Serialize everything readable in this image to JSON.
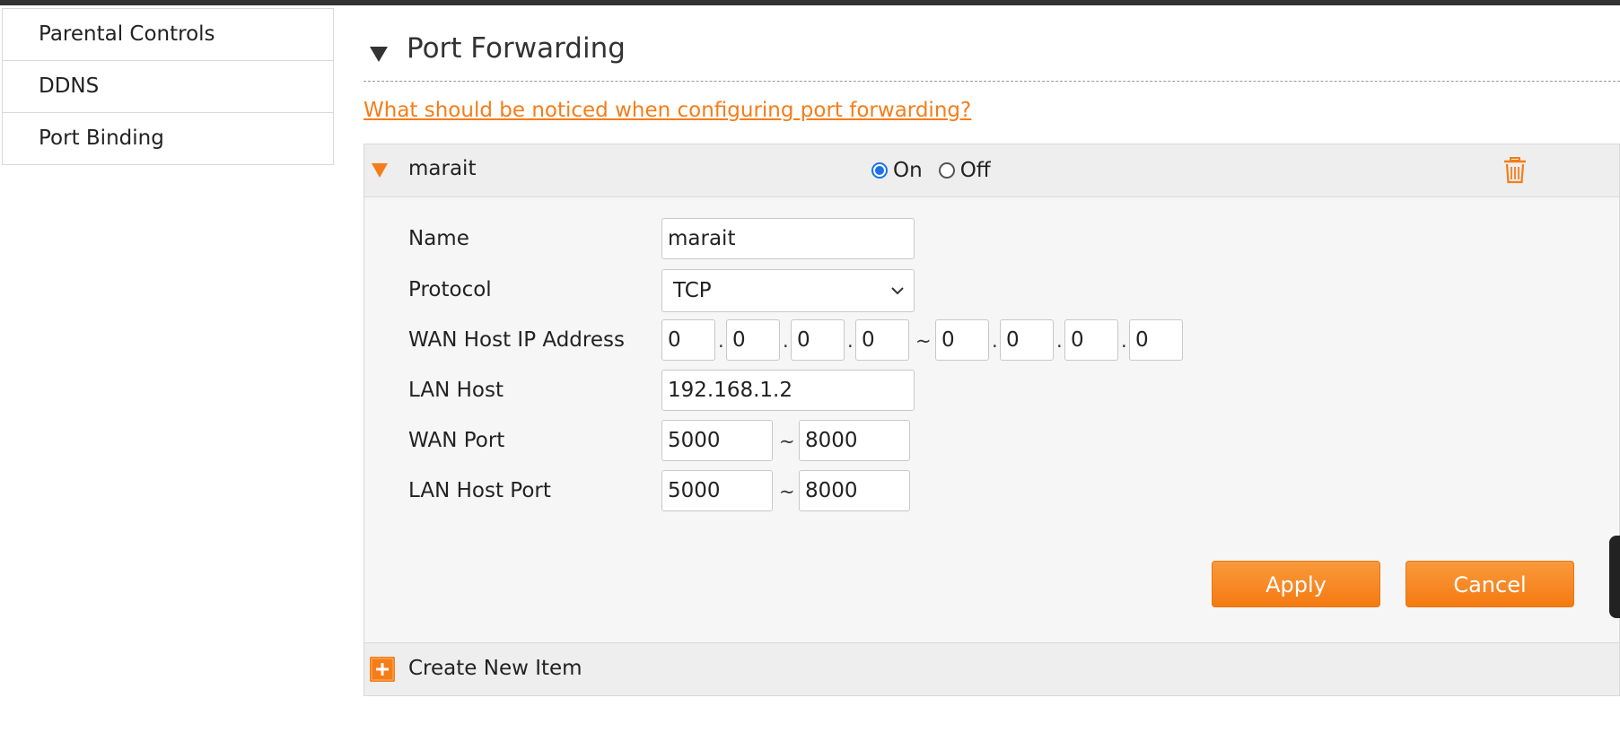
{
  "sidebar": {
    "items": [
      {
        "label": "Parental Controls"
      },
      {
        "label": "DDNS"
      },
      {
        "label": "Port Binding"
      }
    ]
  },
  "section": {
    "title": "Port Forwarding",
    "help_link": "What should be noticed when configuring port forwarding?"
  },
  "rule": {
    "name": "marait",
    "status_on_label": "On",
    "status_off_label": "Off",
    "status_selected": "On",
    "fields": {
      "name_label": "Name",
      "name_value": "marait",
      "protocol_label": "Protocol",
      "protocol_value": "TCP",
      "wan_ip_label": "WAN Host IP Address",
      "wan_ip_start": [
        "0",
        "0",
        "0",
        "0"
      ],
      "wan_ip_end": [
        "0",
        "0",
        "0",
        "0"
      ],
      "lan_host_label": "LAN Host",
      "lan_host_value": "192.168.1.2",
      "wan_port_label": "WAN Port",
      "wan_port_start": "5000",
      "wan_port_end": "8000",
      "lan_port_label": "LAN Host Port",
      "lan_port_start": "5000",
      "lan_port_end": "8000"
    },
    "range_sep": "~",
    "dot_sep": ".",
    "apply_label": "Apply",
    "cancel_label": "Cancel"
  },
  "create_item_label": "Create New Item",
  "colors": {
    "accent": "#f57d18",
    "radio": "#1a73e8"
  },
  "icons": {
    "collapse": "triangle-down-icon",
    "rule_expand": "orange-triangle-down-icon",
    "delete": "trash-icon",
    "dropdown": "chevron-down-icon",
    "create": "plus-icon"
  }
}
